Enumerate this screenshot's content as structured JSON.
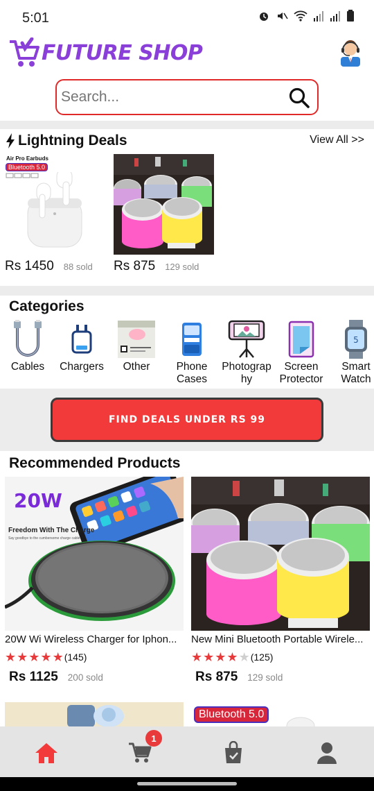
{
  "status_bar": {
    "time": "5:01",
    "icons": [
      "alarm-icon",
      "mute-icon",
      "wifi-icon",
      "signal-icon",
      "signal-icon",
      "battery-icon"
    ]
  },
  "header": {
    "logo_text": "FUTURE SHOP",
    "brand_color": "#8a3fd8",
    "accent_color": "#f23a3a"
  },
  "search": {
    "placeholder": "Search..."
  },
  "lightning_deals": {
    "title": "Lightning Deals",
    "view_all": "View All >>",
    "items": [
      {
        "price": "Rs 1450",
        "sold": "88 sold",
        "badge_title": "Air Pro Earbuds",
        "badge_tag": "Bluetooth 5.0"
      },
      {
        "price": "Rs 875",
        "sold": "129 sold"
      }
    ]
  },
  "categories": {
    "title": "Categories",
    "items": [
      {
        "label": "Cables",
        "icon": "cable-icon"
      },
      {
        "label": "Chargers",
        "icon": "charger-icon"
      },
      {
        "label": "Other",
        "icon": "other-icon"
      },
      {
        "label": "Phone Cases",
        "icon": "phone-case-icon"
      },
      {
        "label": "Photograp hy",
        "icon": "photography-icon"
      },
      {
        "label": "Screen Protector",
        "icon": "screen-protector-icon"
      },
      {
        "label": "Smart Watch",
        "icon": "smartwatch-icon"
      }
    ]
  },
  "deals_button": {
    "label": "FIND DEALS UNDER RS 99"
  },
  "recommended": {
    "title": "Recommended Products",
    "products": [
      {
        "name": "20W Wi Wireless Charger for Iphon...",
        "rating": 5,
        "reviews": "(145)",
        "price": "Rs 1125",
        "sold": "200 sold",
        "promo_big": "20W",
        "promo_line": "Freedom With The Charge",
        "promo_small": "Say goodbye to the cumbersome charge cable"
      },
      {
        "name": "New Mini Bluetooth Portable Wirele...",
        "rating": 4,
        "reviews": "(125)",
        "price": "Rs 875",
        "sold": "129 sold"
      }
    ],
    "next_row_tag": "Bluetooth 5.0"
  },
  "bottom_nav": {
    "items": [
      {
        "icon": "home-icon",
        "active": true
      },
      {
        "icon": "cart-icon",
        "badge": "1"
      },
      {
        "icon": "shopping-bag-icon"
      },
      {
        "icon": "profile-icon"
      }
    ]
  }
}
